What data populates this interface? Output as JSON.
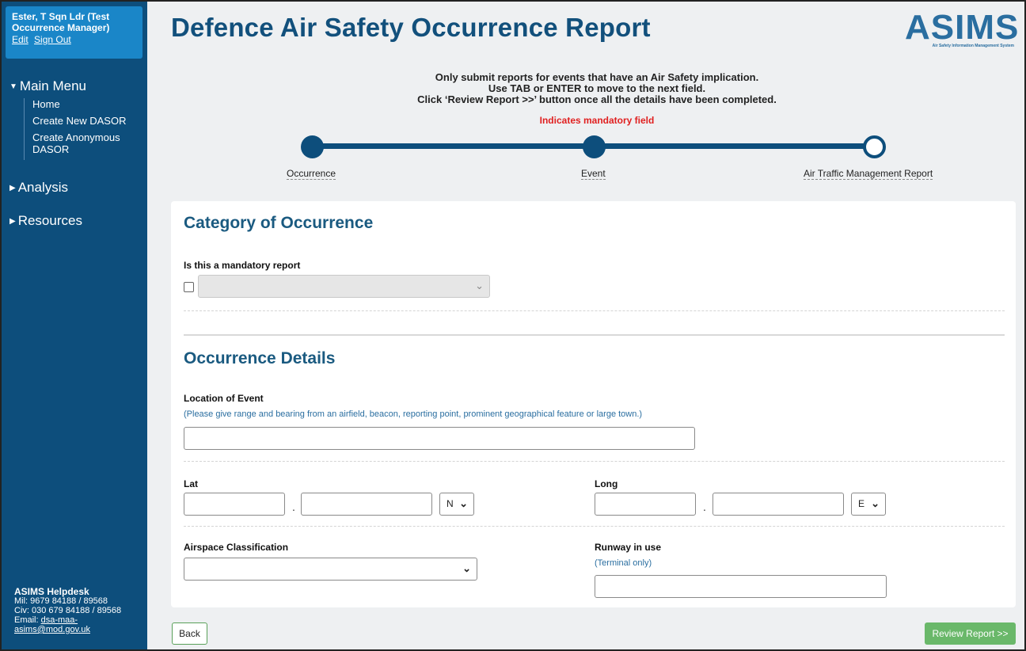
{
  "user": {
    "name": "Ester, T Sqn Ldr (Test Occurrence Manager)",
    "edit_label": "Edit",
    "signout_label": "Sign Out"
  },
  "nav": {
    "main_menu": "Main Menu",
    "items": [
      "Home",
      "Create New DASOR",
      "Create Anonymous DASOR"
    ],
    "analysis": "Analysis",
    "resources": "Resources"
  },
  "helpdesk": {
    "title": "ASIMS Helpdesk",
    "mil": "Mil: 9679 84188 / 89568",
    "civ": "Civ: 030 679 84188 / 89568",
    "email_label": "Email:",
    "email_part1": "dsa-maa-",
    "email_part2": "asims@mod.gov.uk"
  },
  "header": {
    "title": "Defence Air Safety Occurrence Report",
    "logo_word": "ASIMS",
    "logo_sub": "Air Safety Information Management System"
  },
  "instructions": {
    "line1": "Only submit reports for events that have an Air Safety implication.",
    "line2": "Use TAB or ENTER to move to the next field.",
    "line3": "Click ‘Review Report >>’ button once all the details have been completed.",
    "mandatory": "Indicates mandatory field"
  },
  "steps": [
    {
      "label": "Occurrence",
      "state": "complete"
    },
    {
      "label": "Event",
      "state": "complete"
    },
    {
      "label": "Air Traffic Management Report",
      "state": "current"
    }
  ],
  "form": {
    "category_title": "Category of Occurrence",
    "mandatory_report_label": "Is this a mandatory report",
    "mandatory_report_value": "",
    "details_title": "Occurrence Details",
    "location_label": "Location of Event",
    "location_hint": "(Please give range and bearing from an airfield, beacon, reporting point, prominent geographical feature or large town.)",
    "location_value": "",
    "lat_label": "Lat",
    "lat_hemisphere": "N",
    "long_label": "Long",
    "long_hemisphere": "E",
    "separator": ".",
    "airspace_label": "Airspace Classification",
    "airspace_value": "",
    "runway_label": "Runway in use",
    "runway_hint": "(Terminal only)",
    "runway_value": ""
  },
  "buttons": {
    "back": "Back",
    "review": "Review Report >>"
  },
  "colors": {
    "brand": "#0d4e7c",
    "accent": "#1a86c8",
    "mandatory": "#e02020",
    "review_button": "#6ab86a"
  }
}
